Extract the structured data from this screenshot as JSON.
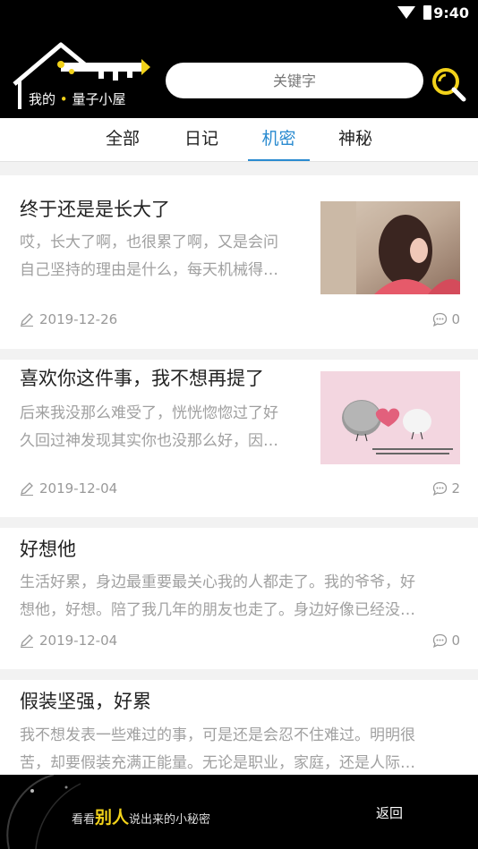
{
  "status_bar": {
    "time": "9:40"
  },
  "header": {
    "logo_text_a": "我的",
    "logo_text_b": "量子小屋",
    "search_placeholder": "关键字"
  },
  "tabs": [
    {
      "label": "全部"
    },
    {
      "label": "日记"
    },
    {
      "label": "机密",
      "active": true
    },
    {
      "label": "神秘"
    }
  ],
  "posts": [
    {
      "title": "终于还是是长大了",
      "excerpt_lines": [
        "哎，长大了啊，也很累了啊，又是会问",
        "自己坚持的理由是什么，每天机械得…"
      ],
      "date": "2019-12-26",
      "comments": "0",
      "has_image": true
    },
    {
      "title": "喜欢你这件事，我不想再提了",
      "excerpt_lines": [
        "后来我没那么难受了，恍恍惚惚过了好",
        "久回过神发现其实你也没那么好，因…"
      ],
      "date": "2019-12-04",
      "comments": "2",
      "has_image": true
    },
    {
      "title": "好想他",
      "excerpt_lines": [
        "生活好累，身边最重要最关心我的人都走了。我的爷爷，好",
        "想他，好想。陪了我几年的朋友也走了。身边好像已经没…"
      ],
      "date": "2019-12-04",
      "comments": "0",
      "has_image": false
    },
    {
      "title": "假装坚强，好累",
      "excerpt_lines": [
        "我不想发表一些难过的事，可是还是会忍不住难过。明明很",
        "苦，却要假装充满正能量。无论是职业，家庭，还是人际…"
      ],
      "has_image": false
    }
  ],
  "footer": {
    "pre": "看看",
    "highlight": "别人",
    "post": "说出来的小秘密",
    "back_label": "返回"
  },
  "colors": {
    "accent": "#2a8bd0",
    "brand_yellow": "#f2d21a",
    "header_bg": "#000000"
  }
}
